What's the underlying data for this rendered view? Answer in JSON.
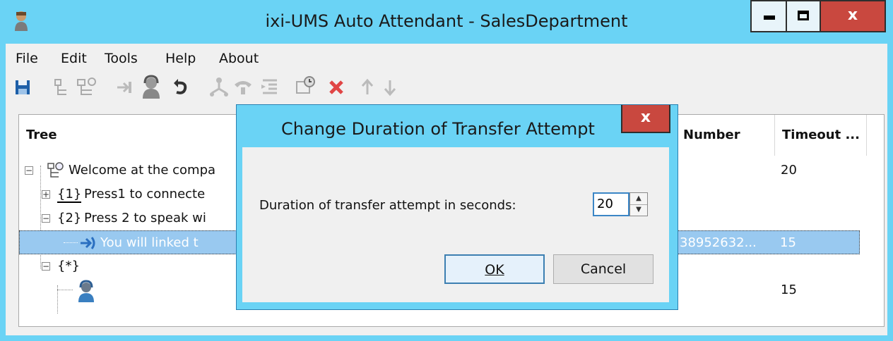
{
  "window": {
    "title": "ixi-UMS Auto Attendant - SalesDepartment",
    "close_glyph": "x"
  },
  "menu": [
    "File",
    "Edit",
    "Tools",
    "Help",
    "About"
  ],
  "toolbar_icons": [
    "save-icon",
    "tree-add-icon",
    "tree-node-icon",
    "transfer-icon",
    "operator-icon",
    "undo-icon",
    "network-icon",
    "phone-icon",
    "indent-icon",
    "schedule-icon",
    "delete-icon",
    "arrow-up-icon",
    "arrow-down-icon"
  ],
  "grid": {
    "columns": {
      "tree": "Tree",
      "number": "Number",
      "timeout": "Timeout ..."
    },
    "rows": [
      {
        "text": "Welcome at the compa",
        "number": "",
        "timeout": "20"
      },
      {
        "key": "{1}",
        "text": "Press1 to connecte",
        "number": "",
        "timeout": ""
      },
      {
        "key": "{2}",
        "text": "Press 2 to speak wi",
        "number": "",
        "timeout": ""
      },
      {
        "text": "You will linked t",
        "number": "38952632...",
        "timeout": "15"
      },
      {
        "key": "{*}",
        "text": "",
        "number": "",
        "timeout": ""
      },
      {
        "text": "",
        "number": "",
        "timeout": "15"
      }
    ]
  },
  "dialog": {
    "title": "Change Duration of Transfer Attempt",
    "close_glyph": "x",
    "label": "Duration of transfer attempt in seconds:",
    "value": "20",
    "ok": "OK",
    "cancel": "Cancel"
  },
  "colors": {
    "titlebar": "#6ad3f5",
    "close_button": "#c9483f",
    "selection": "#99c9f0"
  }
}
